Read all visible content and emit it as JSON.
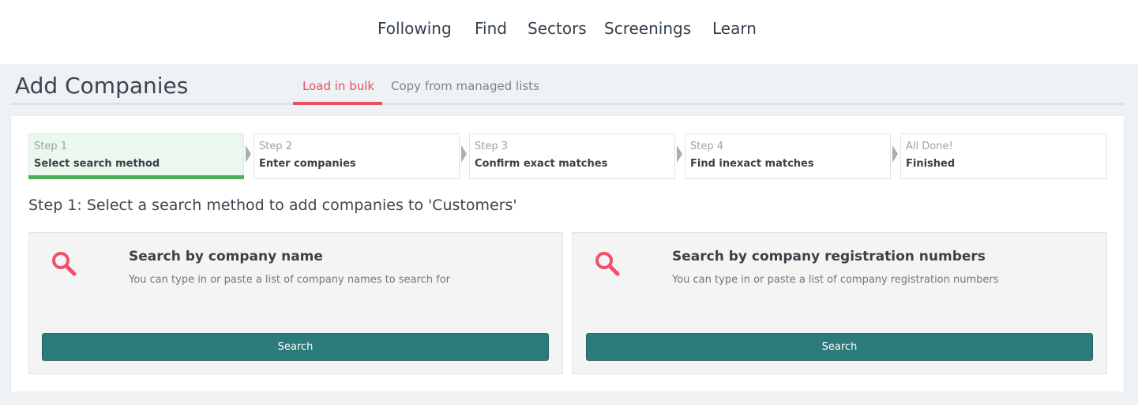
{
  "topnav": {
    "items": [
      "Following",
      "Find",
      "Sectors",
      "Screenings",
      "Learn"
    ]
  },
  "header": {
    "title": "Add Companies",
    "tabs": [
      {
        "label": "Load in bulk",
        "active": true
      },
      {
        "label": "Copy from managed lists",
        "active": false
      }
    ]
  },
  "steps": [
    {
      "number": "Step 1",
      "label": "Select search method",
      "active": true
    },
    {
      "number": "Step 2",
      "label": "Enter companies",
      "active": false
    },
    {
      "number": "Step 3",
      "label": "Confirm exact matches",
      "active": false
    },
    {
      "number": "Step 4",
      "label": "Find inexact matches",
      "active": false
    },
    {
      "number": "All Done!",
      "label": "Finished",
      "active": false
    }
  ],
  "step_heading": "Step 1: Select a search method to add companies to 'Customers'",
  "options": [
    {
      "icon": "search-icon",
      "title": "Search by company name",
      "description": "You can type in or paste a list of company names to search for",
      "button": "Search"
    },
    {
      "icon": "search-icon",
      "title": "Search by company registration numbers",
      "description": "You can type in or paste a list of company registration numbers",
      "button": "Search"
    }
  ],
  "colors": {
    "accent": "#e8505f",
    "button": "#2b7b7a",
    "progress": "#4caf5c"
  }
}
